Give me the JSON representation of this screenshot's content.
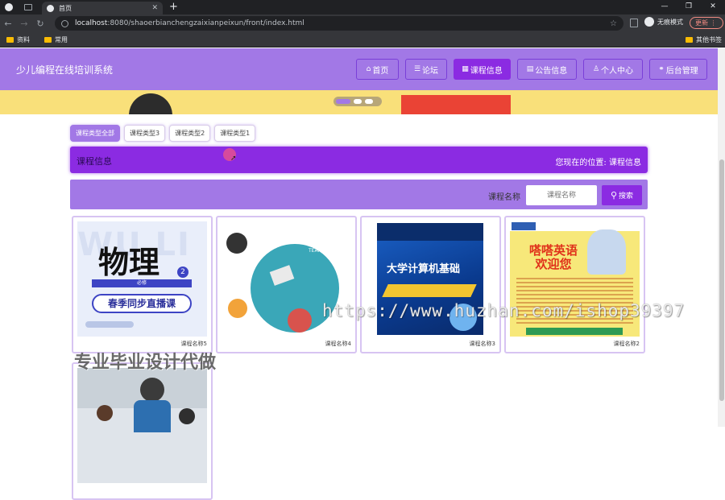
{
  "browser": {
    "tab_title": "首页",
    "url_host": "localhost",
    "url_rest": ":8080/shaoerbianchengzaixianpeixun/front/index.html",
    "incognito_label": "无痕模式",
    "update_label": "更新",
    "bookmarks": [
      "资料",
      "常用"
    ],
    "other_bookmarks": "其他书签"
  },
  "site": {
    "title": "少儿编程在线培训系统",
    "nav": [
      {
        "label": "首页",
        "icon": "home-icon"
      },
      {
        "label": "论坛",
        "icon": "forum-icon"
      },
      {
        "label": "课程信息",
        "icon": "grid-icon"
      },
      {
        "label": "公告信息",
        "icon": "notice-icon"
      },
      {
        "label": "个人中心",
        "icon": "user-icon"
      },
      {
        "label": "后台管理",
        "icon": "link-icon"
      }
    ]
  },
  "type_tabs": [
    "课程类型全部",
    "课程类型3",
    "课程类型2",
    "课程类型1"
  ],
  "info_bar": {
    "title": "课程信息",
    "location": "您现在的位置: 课程信息"
  },
  "search": {
    "label": "课程名称",
    "placeholder": "课程名称",
    "button": "搜索"
  },
  "courses": [
    {
      "name": "课程名称5",
      "cover_text": [
        "WU LI",
        "物理",
        "2",
        "必修",
        "春季同步直播课"
      ]
    },
    {
      "name": "课程名称4",
      "cover_text": [
        "CREATIVE",
        "TEAM"
      ]
    },
    {
      "name": "课程名称3",
      "cover_text": [
        "大学计算机基础"
      ]
    },
    {
      "name": "课程名称2",
      "cover_text": [
        "嗒嗒英语",
        "欢迎您"
      ]
    },
    {
      "name": "",
      "cover_text": []
    }
  ],
  "watermarks": {
    "url": "https://www.huzhan.com/ishop39397",
    "text": "专业毕业设计代做"
  },
  "colors": {
    "primary": "#a278e6",
    "accent": "#8b2be2",
    "banner": "#f9e07a"
  }
}
